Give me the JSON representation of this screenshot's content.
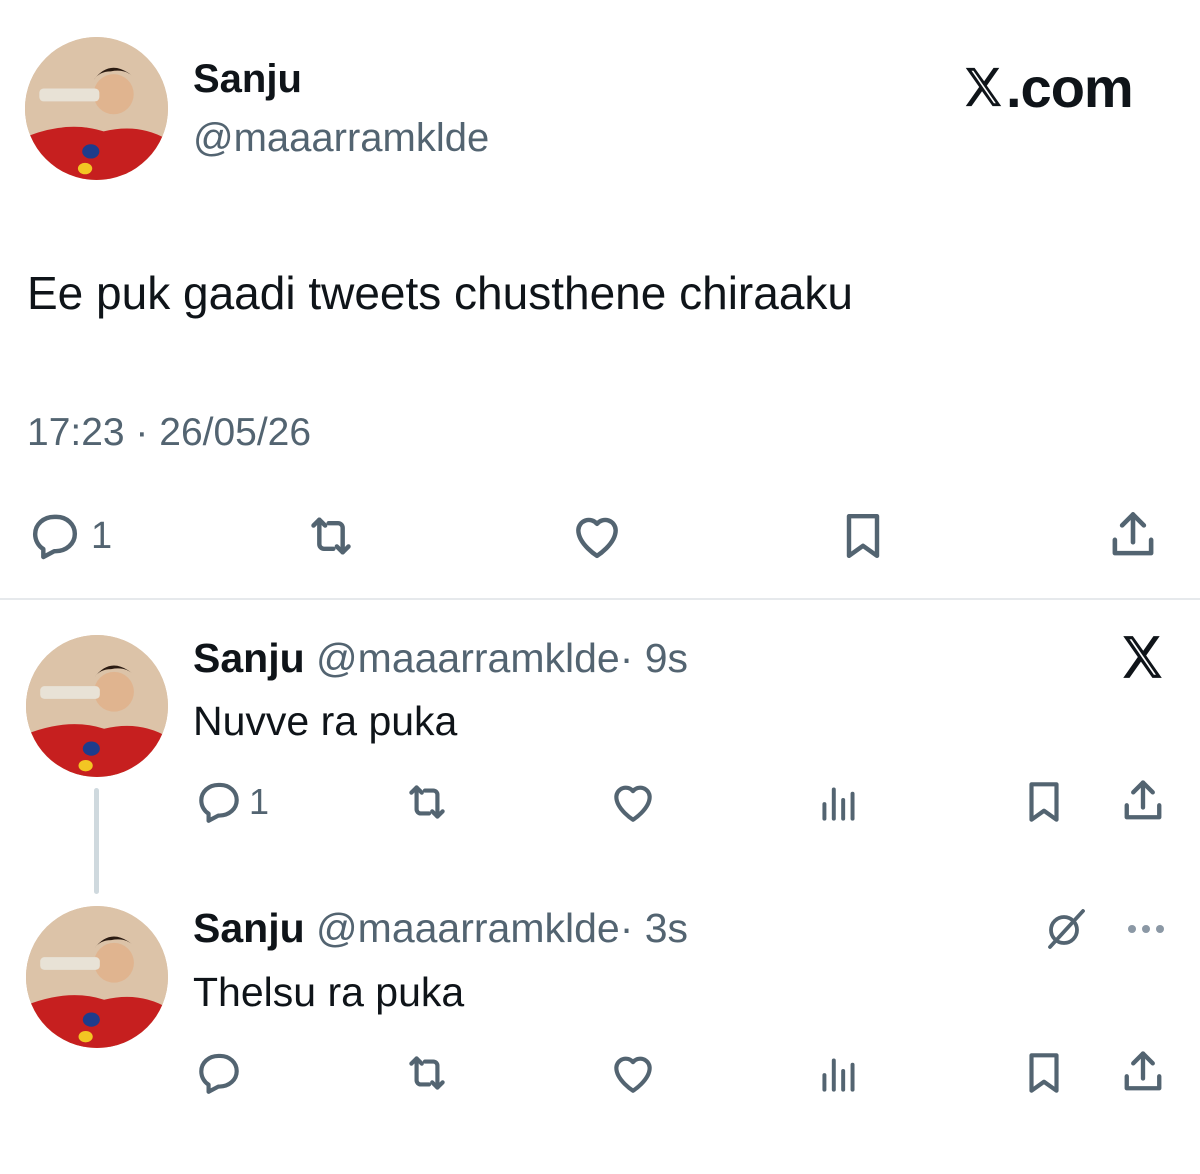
{
  "main_tweet": {
    "name": "Sanju",
    "handle": "@maaarramklde",
    "brand": "X.com",
    "text": "Ee puk gaadi tweets chusthene chiraaku",
    "timestamp": "17:23 · 26/05/26",
    "actions": {
      "reply_count": "1"
    }
  },
  "replies": [
    {
      "name": "Sanju",
      "handle": "@maaarramklde",
      "time": "· 9s",
      "text": "Nuvve ra puka",
      "reply_count": "1"
    },
    {
      "name": "Sanju",
      "handle": "@maaarramklde",
      "time": "· 3s",
      "text": "Thelsu ra puka",
      "reply_count": ""
    }
  ],
  "icons": [
    "reply-icon",
    "retweet-icon",
    "like-icon",
    "bookmark-icon",
    "share-icon",
    "views-icon",
    "x-logo-icon",
    "grok-icon",
    "more-icon"
  ],
  "colors": {
    "text": "#0f1419",
    "secondary": "#536471",
    "divider": "#e6e9ec",
    "thread_line": "#cfd9de"
  }
}
